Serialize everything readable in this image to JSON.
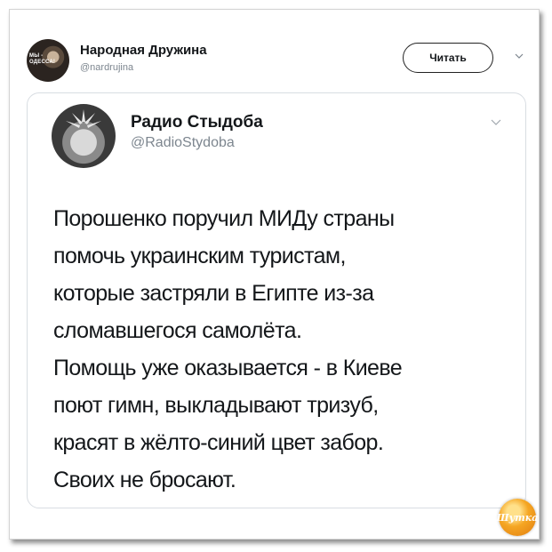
{
  "outer_tweet": {
    "name": "Народная Дружина",
    "handle": "@nardrujina",
    "avatar_text": "МЫ - ОДЕССА!",
    "follow_label": "Читать"
  },
  "quoted_tweet": {
    "name": "Радио Стыдоба",
    "handle": "@RadioStydoba",
    "text_lines": [
      "Порошенко поручил МИДу страны",
      "помочь украинским туристам,",
      "которые застряли в Египте из-за",
      "сломавшегося самолёта.",
      "Помощь уже оказывается - в Киеве",
      "поют гимн, выкладывают тризуб,",
      "красят в жёлто-синий цвет забор.",
      "Своих не бросают."
    ]
  },
  "watermark": {
    "text": "Шутка"
  },
  "icons": {
    "outer_menu": "chevron-down-icon",
    "quote_menu": "chevron-down-icon"
  },
  "colors": {
    "text_primary": "#14171a",
    "text_secondary": "#7d868f",
    "border": "#d8dde2",
    "logo": "#f5a623"
  }
}
